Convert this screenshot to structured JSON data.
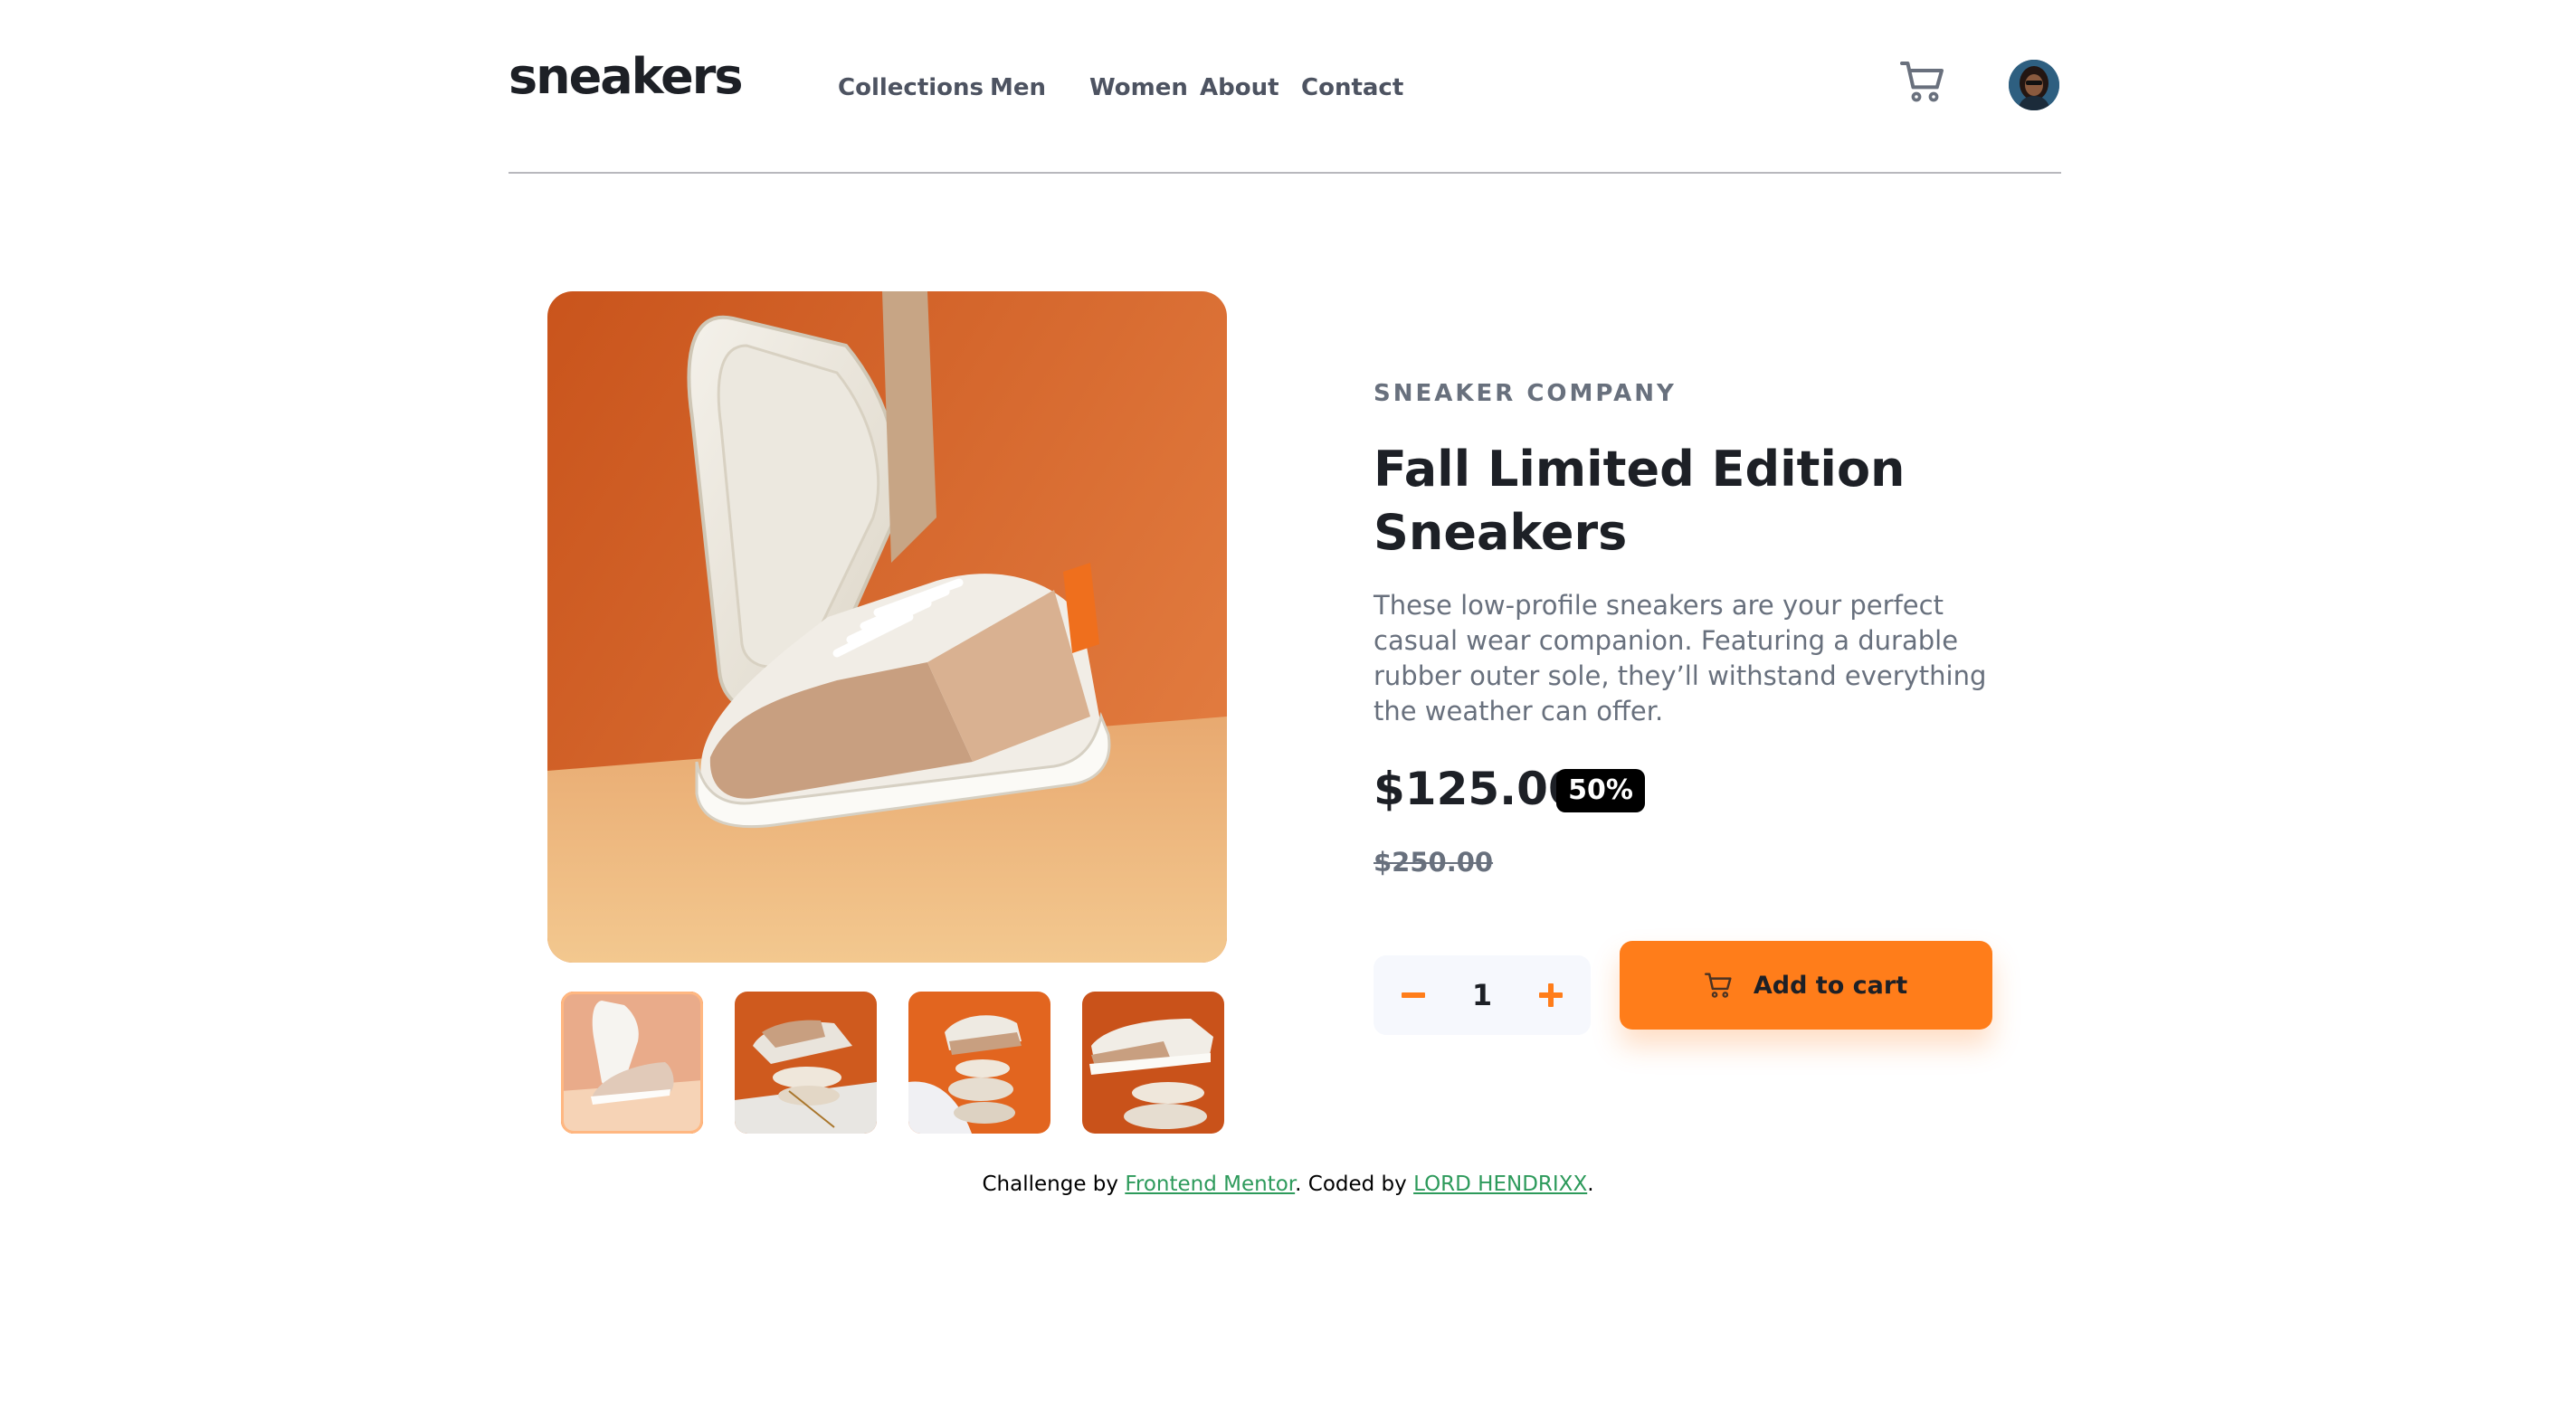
{
  "header": {
    "logo": "sneakers",
    "nav": [
      "Collections",
      "Men",
      "Women",
      "About",
      "Contact"
    ],
    "cart_icon": "cart-icon",
    "avatar_icon": "user-avatar"
  },
  "gallery": {
    "main_image": "sneaker-product-photo",
    "thumbnails": [
      "thumbnail-1",
      "thumbnail-2",
      "thumbnail-3",
      "thumbnail-4"
    ],
    "active_thumbnail": 1
  },
  "product": {
    "company": "SNEAKER COMPANY",
    "title": "Fall Limited Edition Sneakers",
    "description": "These low-profile sneakers are your perfect casual wear companion. Featuring a durable rubber outer sole, they’ll withstand everything the weather can offer.",
    "price": "$125.00",
    "discount": "50%",
    "original_price": "$250.00",
    "quantity": "1",
    "add_to_cart_label": "Add to cart"
  },
  "footer": {
    "prefix": "Challenge by ",
    "frontend_mentor_link": "Frontend Mentor",
    "middle": ". Coded by ",
    "author_link": "LORD HENDRIXX",
    "suffix": "."
  },
  "colors": {
    "accent": "#ff7d1a",
    "dark_text": "#1d2026",
    "muted_text": "#68707d",
    "link": "#2d9a5b"
  }
}
